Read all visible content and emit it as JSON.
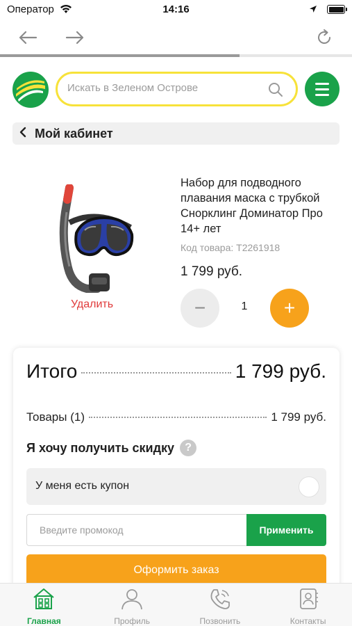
{
  "status_bar": {
    "carrier": "Оператор",
    "time": "14:16"
  },
  "browser": {
    "progress": 0.68
  },
  "header": {
    "search_placeholder": "Искать в Зеленом Острове"
  },
  "breadcrumb": {
    "label": "Мой кабинет"
  },
  "cart_item": {
    "title": "Набор для подводного плавания маска с трубкой Снорклинг Доминатор Про 14+ лет",
    "code": "Код товара: T2261918",
    "price": "1 799 руб.",
    "quantity": "1",
    "delete_label": "Удалить",
    "minus_label": "−",
    "plus_label": "+"
  },
  "summary": {
    "total_label": "Итого",
    "total_value": "1 799 руб.",
    "goods_label": "Товары (1)",
    "goods_value": "1 799 руб.",
    "discount_label": "Я хочу получить скидку",
    "help_label": "?",
    "coupon_label": "У меня есть купон",
    "promo_placeholder": "Введите промокод",
    "apply_label": "Применить",
    "checkout_label": "Оформить заказ"
  },
  "tabbar": {
    "items": [
      {
        "label": "Главная",
        "icon": "home-icon",
        "active": true
      },
      {
        "label": "Профиль",
        "icon": "profile-icon",
        "active": false
      },
      {
        "label": "Позвонить",
        "icon": "phone-icon",
        "active": false
      },
      {
        "label": "Контакты",
        "icon": "contacts-icon",
        "active": false
      }
    ]
  },
  "colors": {
    "brand_green": "#1aa24a",
    "accent_orange": "#f7a21b",
    "search_border": "#f7e23a",
    "delete_red": "#e03a3a"
  }
}
